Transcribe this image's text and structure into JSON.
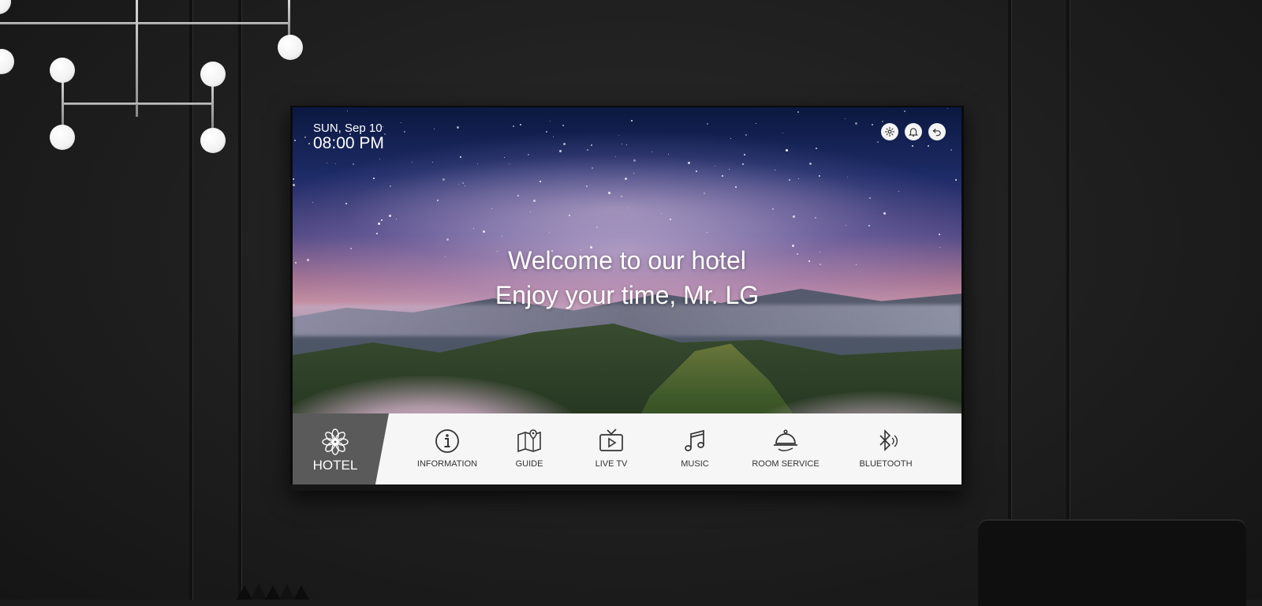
{
  "screen": {
    "date": "SUN, Sep 10",
    "time": "08:00 PM",
    "welcome_line1": "Welcome to our hotel",
    "welcome_line2": "Enjoy your time, Mr. LG"
  },
  "top_icons": [
    "settings-icon",
    "bell-icon",
    "back-icon"
  ],
  "menu": {
    "active": "HOTEL",
    "hotel_label": "HOTEL",
    "items": [
      {
        "label": "INFORMATION",
        "icon": "info-icon"
      },
      {
        "label": "GUIDE",
        "icon": "map-pin-icon"
      },
      {
        "label": "LIVE TV",
        "icon": "tv-play-icon"
      },
      {
        "label": "MUSIC",
        "icon": "music-note-icon"
      },
      {
        "label": "ROOM SERVICE",
        "icon": "cloche-icon"
      },
      {
        "label": "BLUETOOTH",
        "icon": "bluetooth-icon"
      }
    ]
  },
  "colors": {
    "menu_bg": "#f6f6f6",
    "active_tab": "#5a5a5a",
    "wall": "#1e1e1e"
  }
}
